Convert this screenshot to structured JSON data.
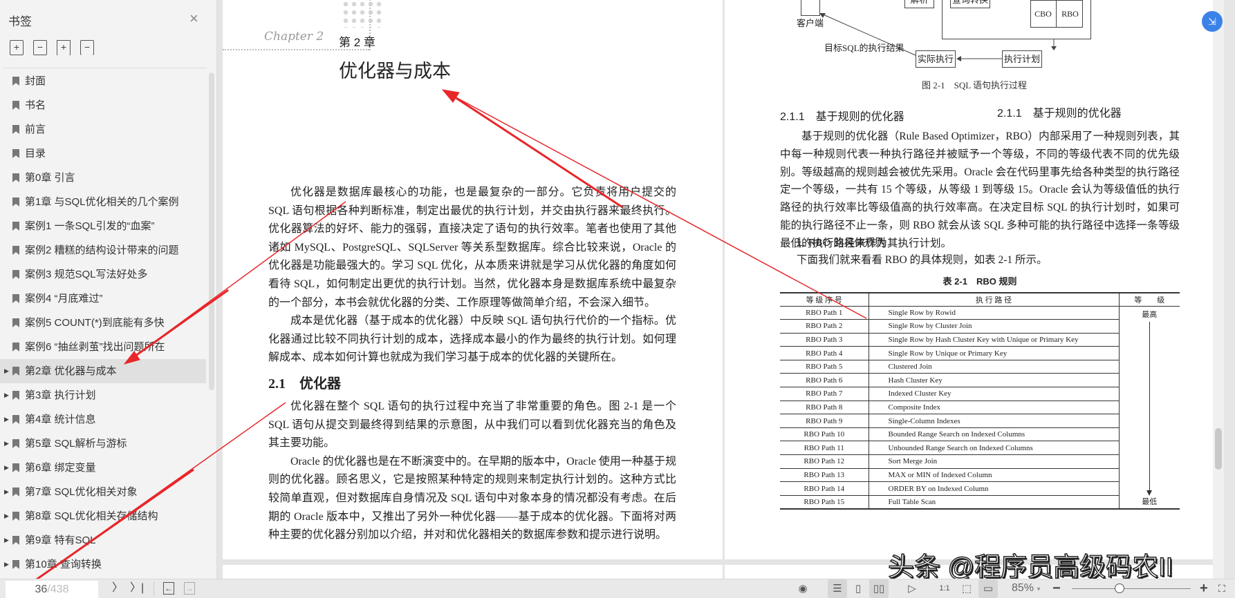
{
  "sidebar": {
    "title": "书签",
    "close_icon": "×",
    "tools": [
      "expand-all",
      "collapse-all",
      "add-bookmark",
      "remove-bookmark"
    ],
    "items": [
      {
        "label": "封面",
        "expandable": false
      },
      {
        "label": "书名",
        "expandable": false
      },
      {
        "label": "前言",
        "expandable": false
      },
      {
        "label": "目录",
        "expandable": false
      },
      {
        "label": "第0章 引言",
        "expandable": false
      },
      {
        "label": "第1章 与SQL优化相关的几个案例",
        "expandable": false
      },
      {
        "label": "案例1 一条SQL引发的“血案”",
        "expandable": false
      },
      {
        "label": "案例2 糟糕的结构设计带来的问题",
        "expandable": false
      },
      {
        "label": "案例3 规范SQL写法好处多",
        "expandable": false
      },
      {
        "label": "案例4 “月底难过”",
        "expandable": false
      },
      {
        "label": "案例5 COUNT(*)到底能有多快",
        "expandable": false
      },
      {
        "label": "案例6 “抽丝剥茧”找出问题所在",
        "expandable": false
      },
      {
        "label": "第2章 优化器与成本",
        "expandable": true,
        "selected": true
      },
      {
        "label": "第3章 执行计划",
        "expandable": true
      },
      {
        "label": "第4章 统计信息",
        "expandable": true
      },
      {
        "label": "第5章 SQL解析与游标",
        "expandable": true
      },
      {
        "label": "第6章 绑定变量",
        "expandable": true
      },
      {
        "label": "第7章 SQL优化相关对象",
        "expandable": true
      },
      {
        "label": "第8章 SQL优化相关存储结构",
        "expandable": true
      },
      {
        "label": "第9章 特有SQL",
        "expandable": true
      },
      {
        "label": "第10章 查询转换",
        "expandable": true
      }
    ]
  },
  "left_page": {
    "chapter_logo": "Chapter 2",
    "chapter_no": "第 2 章",
    "chapter_title": "优化器与成本",
    "paras1": [
      "优化器是数据库最核心的功能，也是最复杂的一部分。它负责将用户提交的 SQL 语句根据各种判断标准，制定出最优的执行计划，并交由执行器来最终执行。优化器算法的好坏、能力的强弱，直接决定了语句的执行效率。笔者也使用了其他诸如 MySQL、PostgreSQL、SQLServer 等关系型数据库。综合比较来说，Oracle 的优化器是功能最强大的。学习 SQL 优化，从本质来讲就是学习从优化器的角度如何看待 SQL，如何制定出更优的执行计划。当然，优化器本身是数据库系统中最复杂的一个部分，本书会就优化器的分类、工作原理等做简单介绍，不会深入细节。",
      "成本是优化器（基于成本的优化器）中反映 SQL 语句执行代价的一个指标。优化器通过比较不同执行计划的成本，选择成本最小的作为最终的执行计划。如何理解成本、成本如何计算也就成为我们学习基于成本的优化器的关键所在。"
    ],
    "section_heading": "2.1　优化器",
    "paras2": [
      "优化器在整个 SQL 语句的执行过程中充当了非常重要的角色。图 2-1 是一个 SQL 语句从提交到最终得到结果的示意图，从中我们可以看到优化器充当的角色及其主要功能。",
      "Oracle 的优化器也是在不断演变中的。在早期的版本中，Oracle 使用一种基于规则的优化器。顾名思义，它是按照某种特定的规则来制定执行计划的。这种方式比较简单直观，但对数据库自身情况及 SQL 语句中对象本身的情况都没有考虑。在后期的 Oracle 版本中，又推出了另外一种优化器——基于成本的优化器。下面将对两种主要的优化器分别加以介绍，并对和优化器相关的数据库参数和提示进行说明。"
    ]
  },
  "right_page": {
    "diagram": {
      "parse": "解析",
      "transform": "查询转换",
      "cbo": "CBO",
      "rbo": "RBO",
      "client": "客户端",
      "result": "目标SQL的执行结果",
      "execute": "实际执行",
      "plan": "执行计划"
    },
    "figure_caption": "图 2-1　SQL 语句执行过程",
    "subsection_heading": "2.1.1　基于规则的优化器",
    "para": "基于规则的优化器（Rule Based Optimizer，RBO）内部采用了一种规则列表，其中每一种规则代表一种执行路径并被赋予一个等级，不同的等级代表不同的优先级别。等级越高的规则越会被优先采用。Oracle 会在代码里事先给各种类型的执行路径定一个等级，一共有 15 个等级，从等级 1 到等级 15。Oracle 会认为等级值低的执行路径的执行效率比等级值高的执行效率高。在决定目标 SQL 的执行计划时，如果可能的执行路径不止一条，则 RBO 就会从该 SQL 多种可能的执行路径中选择一条等级最低的执行路径来作为其执行计划。",
    "rule_heading": "1. RBO 的具体规则",
    "rule_intro": "下面我们就来看看 RBO 的具体规则，如表 2-1 所示。",
    "table": {
      "caption": "表 2-1　RBO 规则",
      "headers": [
        "等 级 序 号",
        "执 行 路 径",
        "等　　级"
      ],
      "rank_high": "最高",
      "rank_low": "最低",
      "rows": [
        [
          "RBO Path 1",
          "Single Row by Rowid"
        ],
        [
          "RBO Path 2",
          "Single Row by Cluster Join"
        ],
        [
          "RBO Path 3",
          "Single Row by Hash Cluster Key with Unique or Primary Key"
        ],
        [
          "RBO Path 4",
          "Single Row by Unique or Primary Key"
        ],
        [
          "RBO Path 5",
          "Clustered Join"
        ],
        [
          "RBO Path 6",
          "Hash Cluster Key"
        ],
        [
          "RBO Path 7",
          "Indexed Cluster Key"
        ],
        [
          "RBO Path 8",
          "Composite Index"
        ],
        [
          "RBO Path 9",
          "Single-Column Indexes"
        ],
        [
          "RBO Path 10",
          "Bounded Range Search on Indexed Columns"
        ],
        [
          "RBO Path 11",
          "Unbounded Range Search on Indexed Columns"
        ],
        [
          "RBO Path 12",
          "Sort Merge Join"
        ],
        [
          "RBO Path 13",
          "MAX or MIN of Indexed Column"
        ],
        [
          "RBO Path 14",
          "ORDER BY on Indexed Column"
        ],
        [
          "RBO Path 15",
          "Full Table Scan"
        ]
      ]
    }
  },
  "watermark": "头条 @程序员高级码农II",
  "bottom_bar": {
    "current_page": "36",
    "total_pages": "/438",
    "next": "〉",
    "last": "〉|",
    "back": "←",
    "forward": "→",
    "zoom": "85%",
    "zoom_caret": "▾",
    "zoom_out": "−",
    "zoom_in": "+",
    "zoom_level_percent": 85,
    "one_to_one": "1:1"
  },
  "colors": {
    "accent_blue": "#3b82e8",
    "annotation_red": "#e8262a"
  }
}
